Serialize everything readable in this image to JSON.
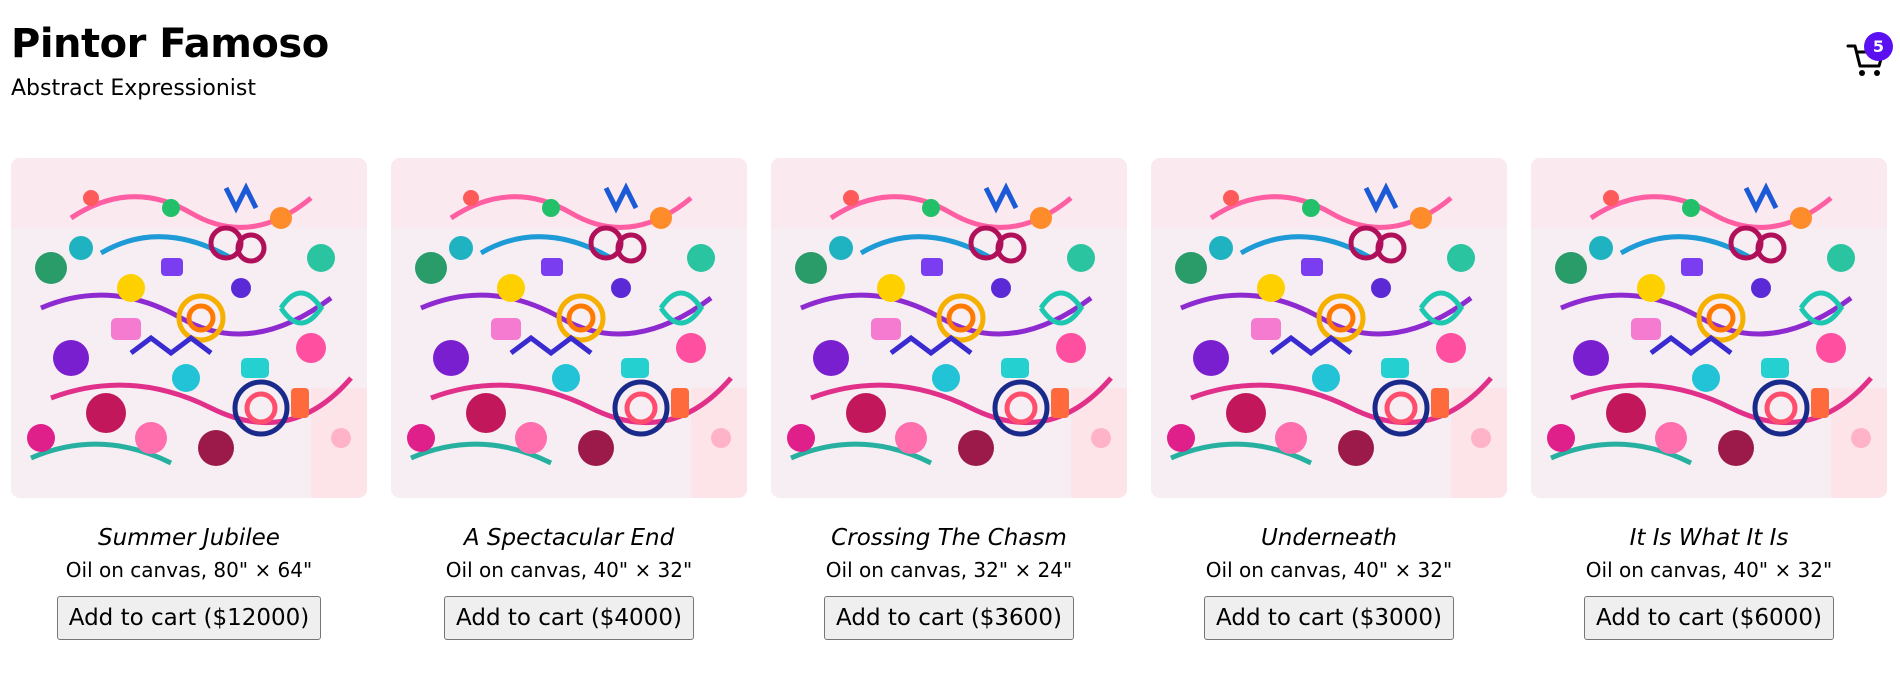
{
  "header": {
    "artist_name": "Pintor Famoso",
    "artist_style": "Abstract Expressionist"
  },
  "cart": {
    "count": "5",
    "icon": "shopping-cart-icon",
    "badge_color": "#5a10f0"
  },
  "paintings": [
    {
      "title": "Summer Jubilee",
      "medium": "Oil on canvas, 80\" × 64\"",
      "button_label": "Add to cart ($12000)"
    },
    {
      "title": "A Spectacular End",
      "medium": "Oil on canvas, 40\" × 32\"",
      "button_label": "Add to cart ($4000)"
    },
    {
      "title": "Crossing The Chasm",
      "medium": "Oil on canvas, 32\" × 24\"",
      "button_label": "Add to cart ($3600)"
    },
    {
      "title": "Underneath",
      "medium": "Oil on canvas, 40\" × 32\"",
      "button_label": "Add to cart ($3000)"
    },
    {
      "title": "It Is What It Is",
      "medium": "Oil on canvas, 40\" × 32\"",
      "button_label": "Add to cart ($6000)"
    }
  ]
}
